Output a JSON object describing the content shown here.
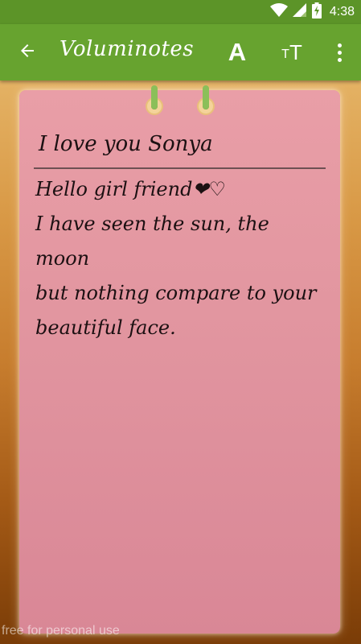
{
  "status_bar": {
    "time": "4:38",
    "icons": [
      "wifi-icon",
      "cellular-signal-icon",
      "battery-charging-icon"
    ]
  },
  "toolbar": {
    "title": "Voluminotes",
    "back_icon": "arrow-left-icon",
    "font_label": "A",
    "text_size_small": "T",
    "text_size_big": "T",
    "more_icon": "more-vertical-icon"
  },
  "note": {
    "title": "I love you Sonya",
    "body": "Hello girl friend❤♡\nI have seen the sun, the moon\nbut nothing compare to your\nbeautiful face."
  },
  "watermark": "free for personal use",
  "colors": {
    "status_bar": "#5c9428",
    "toolbar": "#67a32f",
    "note_paper": "#e296a0",
    "ring": "#8bbf59"
  }
}
